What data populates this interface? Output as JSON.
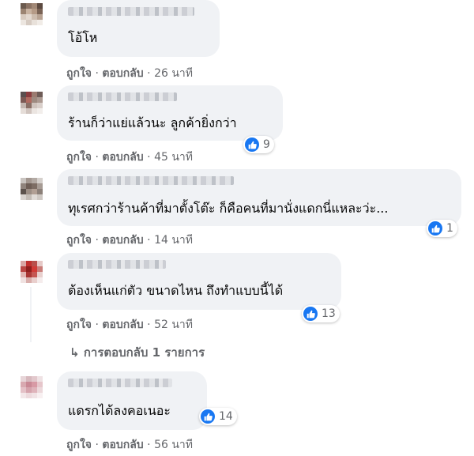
{
  "actions": {
    "like": "ถูกใจ",
    "reply": "ตอบกลับ",
    "sep": "·"
  },
  "colors": {
    "like_blue": "#1877f2",
    "bubble": "#f0f2f5",
    "meta": "#65676b"
  },
  "comments": [
    {
      "text": "โอ้โห",
      "time": "26 นาที",
      "reactions": ""
    },
    {
      "text": "ร้านก็ว่าแย่แล้วนะ ลูกค้ายิ่งกว่า",
      "time": "45 นาที",
      "reactions": "9"
    },
    {
      "text": "ทุเรศกว่าร้านค้าที่มาตั้งโต๊ะ ก็คือคนที่มานั่งแดกนี่แหละว่ะ...",
      "time": "14 นาที",
      "reactions": "1"
    },
    {
      "text": "ต้องเห็นแก่ตัว ขนาดไหน ถึงทำแบบนี้ได้",
      "time": "52 นาที",
      "reactions": "13"
    },
    {
      "text": "แดรกได้ลงคอเนอะ",
      "time": "56 นาที",
      "reactions": "14"
    }
  ],
  "replies_link": "การตอบกลับ 1 รายการ",
  "icons": {
    "reaction": "like-thumb-icon",
    "reply_arrow": "reply-arrow-icon"
  }
}
